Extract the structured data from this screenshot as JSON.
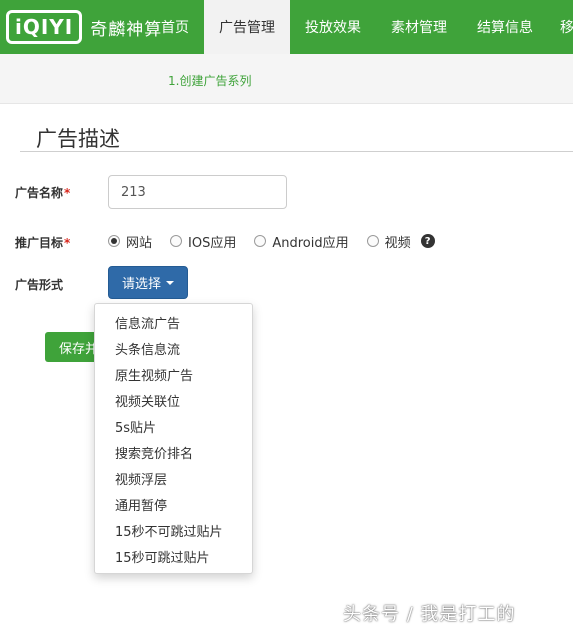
{
  "header": {
    "logo_badge": "iQIYI",
    "logo_text": "奇麟神算",
    "nav": [
      {
        "label": "首页"
      },
      {
        "label": "广告管理"
      },
      {
        "label": "投放效果"
      },
      {
        "label": "素材管理"
      },
      {
        "label": "结算信息"
      },
      {
        "label": "移"
      }
    ],
    "accent": "#3fa33a"
  },
  "steps": {
    "current": "1.创建广告系列"
  },
  "section": {
    "title": "广告描述"
  },
  "form": {
    "name_label": "广告名称",
    "name_value": "213",
    "target_label": "推广目标",
    "required_mark": "*",
    "target_options": [
      {
        "label": "网站",
        "checked": true
      },
      {
        "label": "IOS应用",
        "checked": false
      },
      {
        "label": "Android应用",
        "checked": false
      },
      {
        "label": "视频",
        "checked": false
      }
    ],
    "help_icon": "?",
    "format_label": "广告形式",
    "select_label": "请选择",
    "save_label": "保存并"
  },
  "dropdown": {
    "items": [
      "信息流广告",
      "头条信息流",
      "原生视频广告",
      "视频关联位",
      "5s贴片",
      "搜索竞价排名",
      "视频浮层",
      "通用暂停",
      "15秒不可跳过贴片",
      "15秒可跳过贴片"
    ]
  },
  "watermark": "头条号 / 我是打工的"
}
